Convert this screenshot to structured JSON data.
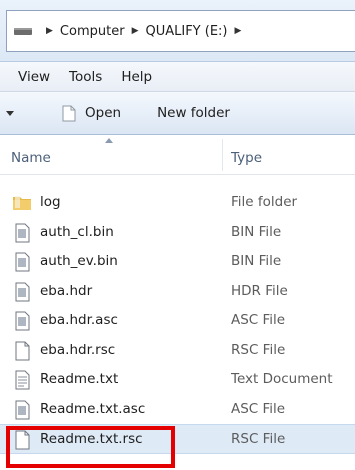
{
  "address": {
    "crumbs": [
      "Computer",
      "QUALIFY (E:)"
    ],
    "separator": "▶"
  },
  "menu": {
    "items": [
      "View",
      "Tools",
      "Help"
    ]
  },
  "command_bar": {
    "open_label": "Open",
    "new_folder_label": "New folder"
  },
  "columns": {
    "name": "Name",
    "type": "Type"
  },
  "files": [
    {
      "name": "log",
      "type": "File folder",
      "icon": "folder-icon"
    },
    {
      "name": "auth_cl.bin",
      "type": "BIN File",
      "icon": "document-icon"
    },
    {
      "name": "auth_ev.bin",
      "type": "BIN File",
      "icon": "document-icon"
    },
    {
      "name": "eba.hdr",
      "type": "HDR File",
      "icon": "document-icon"
    },
    {
      "name": "eba.hdr.asc",
      "type": "ASC File",
      "icon": "document-icon"
    },
    {
      "name": "eba.hdr.rsc",
      "type": "RSC File",
      "icon": "blank-file-icon"
    },
    {
      "name": "Readme.txt",
      "type": "Text Document",
      "icon": "text-file-icon"
    },
    {
      "name": "Readme.txt.asc",
      "type": "ASC File",
      "icon": "document-icon"
    },
    {
      "name": "Readme.txt.rsc",
      "type": "RSC File",
      "icon": "blank-file-icon",
      "selected": true
    }
  ],
  "colors": {
    "highlight": "#e40000",
    "selection": "#dfeaf7",
    "folder": "#e8b84a"
  }
}
